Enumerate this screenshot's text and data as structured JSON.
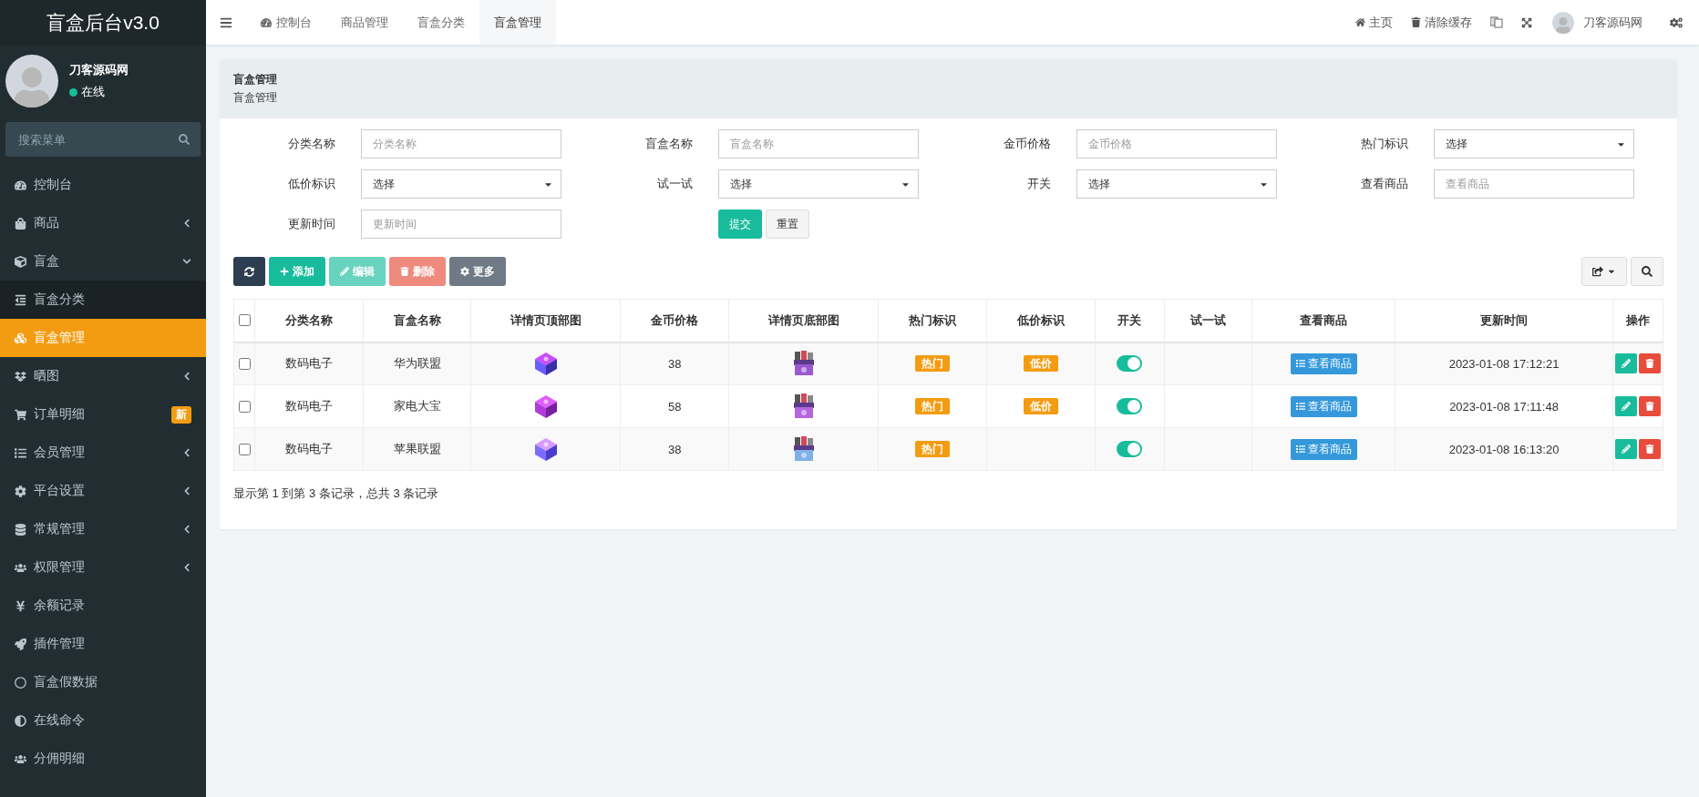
{
  "sidebar": {
    "logo": "盲盒后台v3.0",
    "user": {
      "name": "刀客源码网",
      "status": "在线"
    },
    "search": {
      "placeholder": "搜索菜单"
    },
    "items": [
      {
        "label": "控制台",
        "selected": false
      },
      {
        "label": "商品",
        "selected": false,
        "expanded": false
      },
      {
        "label": "盲盒",
        "selected": false,
        "expanded": true,
        "children": [
          {
            "label": "盲盒分类",
            "selected": false
          },
          {
            "label": "盲盒管理",
            "selected": true
          }
        ]
      },
      {
        "label": "晒图",
        "selected": false,
        "expanded": false
      },
      {
        "label": "订单明细",
        "selected": false,
        "badge": "新"
      },
      {
        "label": "会员管理",
        "selected": false,
        "expanded": false
      },
      {
        "label": "平台设置",
        "selected": false,
        "expanded": false
      },
      {
        "label": "常规管理",
        "selected": false,
        "expanded": false
      },
      {
        "label": "权限管理",
        "selected": false,
        "expanded": false
      },
      {
        "label": "余额记录",
        "selected": false
      },
      {
        "label": "插件管理",
        "selected": false
      },
      {
        "label": "盲盒假数据",
        "selected": false
      },
      {
        "label": "在线命令",
        "selected": false
      },
      {
        "label": "分佣明细",
        "selected": false
      }
    ]
  },
  "topbar": {
    "tabs": [
      {
        "label": "控制台",
        "selected": false
      },
      {
        "label": "商品管理",
        "selected": false
      },
      {
        "label": "盲盒分类",
        "selected": false
      },
      {
        "label": "盲盒管理",
        "selected": true
      }
    ],
    "links": [
      "主页",
      "清除缓存"
    ],
    "user": "刀客源码网"
  },
  "panel": {
    "title": "盲盒管理",
    "subtitle": "盲盒管理"
  },
  "filters": [
    {
      "label": "分类名称",
      "kind": "text",
      "placeholder": "分类名称"
    },
    {
      "label": "盲盒名称",
      "kind": "text",
      "placeholder": "盲盒名称"
    },
    {
      "label": "金币价格",
      "kind": "text",
      "placeholder": "金币价格"
    },
    {
      "label": "热门标识",
      "kind": "select",
      "value": "选择"
    },
    {
      "label": "低价标识",
      "kind": "select",
      "value": "选择"
    },
    {
      "label": "试一试",
      "kind": "select",
      "value": "选择"
    },
    {
      "label": "开关",
      "kind": "select",
      "value": "选择"
    },
    {
      "label": "查看商品",
      "kind": "text",
      "placeholder": "查看商品"
    },
    {
      "label": "更新时间",
      "kind": "text",
      "placeholder": "更新时间"
    }
  ],
  "filter_buttons": [
    "提交",
    "重置"
  ],
  "toolbar": [
    {
      "label": "添加",
      "kind": "add",
      "disabled": false
    },
    {
      "label": "编辑",
      "kind": "edit",
      "disabled": true
    },
    {
      "label": "删除",
      "kind": "delete",
      "disabled": true
    },
    {
      "label": "更多",
      "kind": "more",
      "disabled": false
    }
  ],
  "table": {
    "all_checked": false,
    "columns": [
      "分类名称",
      "盲盒名称",
      "详情页顶部图",
      "金币价格",
      "详情页底部图",
      "热门标识",
      "低价标识",
      "开关",
      "试一试",
      "查看商品",
      "更新时间",
      "操作"
    ],
    "rows": [
      {
        "checked": false,
        "category": "数码电子",
        "name": "华为联盟",
        "price": "38",
        "hot": "热门",
        "cheap": "低价",
        "on": true,
        "view": "查看商品",
        "updated": "2023-01-08 17:12:21"
      },
      {
        "checked": false,
        "category": "数码电子",
        "name": "家电大宝",
        "price": "58",
        "hot": "热门",
        "cheap": "低价",
        "on": true,
        "view": "查看商品",
        "updated": "2023-01-08 17:11:48"
      },
      {
        "checked": false,
        "category": "数码电子",
        "name": "苹果联盟",
        "price": "38",
        "hot": "热门",
        "on": true,
        "view": "查看商品",
        "updated": "2023-01-08 16:13:20"
      }
    ]
  },
  "pagination": "显示第 1 到第 3 条记录，总共 3 条记录"
}
